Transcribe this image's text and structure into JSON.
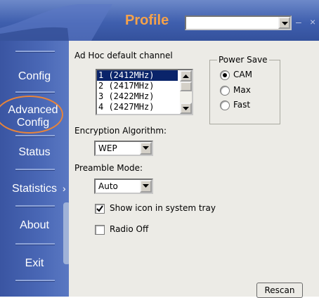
{
  "titlebar": {
    "title": "Profile",
    "profile_value": "",
    "minimize_glyph": "–",
    "close_glyph": "×"
  },
  "sidebar": {
    "items": [
      {
        "label": "Config"
      },
      {
        "label": "Advanced Config",
        "highlighted": true
      },
      {
        "label": "Status"
      },
      {
        "label": "Statistics"
      },
      {
        "label": "About"
      },
      {
        "label": "Exit"
      }
    ],
    "highlight_color": "#e8843a"
  },
  "panel": {
    "channel_label": "Ad Hoc default channel",
    "channels": [
      "1 (2412MHz)",
      "2 (2417MHz)",
      "3 (2422MHz)",
      "4 (2427MHz)"
    ],
    "selected_channel_index": 0,
    "power_save": {
      "title": "Power Save",
      "options": [
        "CAM",
        "Max",
        "Fast"
      ],
      "selected": "CAM"
    },
    "encryption_label": "Encryption Algorithm:",
    "encryption_value": "WEP",
    "preamble_label": "Preamble Mode:",
    "preamble_value": "Auto",
    "show_icon": {
      "label": "Show icon in system tray",
      "checked": true
    },
    "radio_off": {
      "label": "Radio Off",
      "checked": false
    },
    "rescan_label": "Rescan"
  },
  "colors": {
    "title_text": "#f5a24a",
    "sidebar": "#4a68b6",
    "panel": "#ecebe6",
    "selection": "#0a246a"
  }
}
